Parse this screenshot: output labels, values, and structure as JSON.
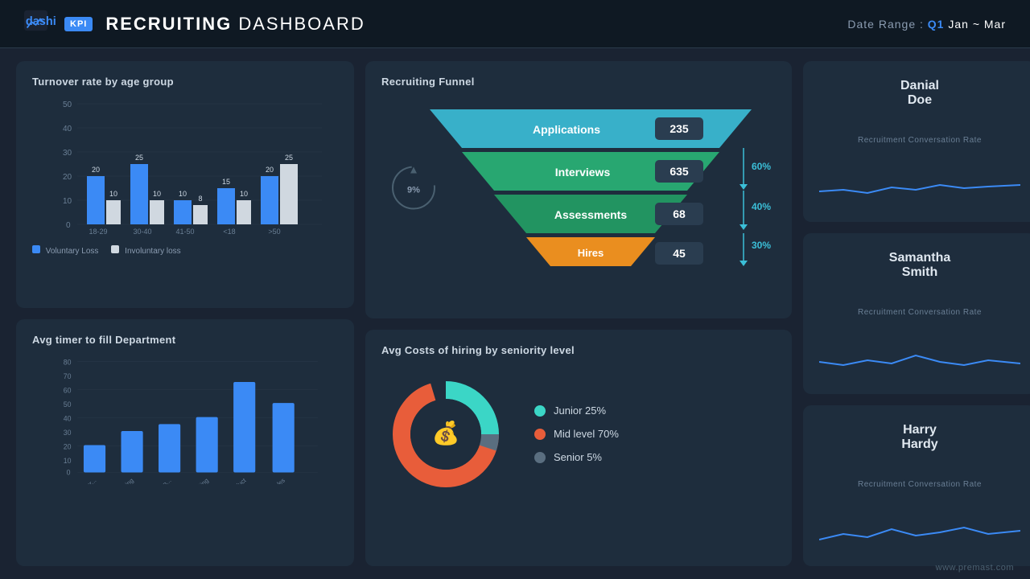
{
  "header": {
    "logo_text": "dashi",
    "kpi_badge": "KPI",
    "title_bold": "RECRUITING",
    "title_thin": "DASHBOARD",
    "date_label": "Date Range :",
    "date_accent": "Q1",
    "date_range": "Jan ~ Mar"
  },
  "turnover": {
    "title": "Turnover rate by age group",
    "y_labels": [
      "50",
      "40",
      "30",
      "20",
      "10",
      "0"
    ],
    "x_labels": [
      "18-29",
      "30-40",
      "41-50",
      "<18",
      ">50"
    ],
    "voluntary_color": "#3b8af5",
    "involuntary_color": "#e0e0e0",
    "legend_voluntary": "Voluntary Loss",
    "legend_involuntary": "Involuntary loss",
    "bars": [
      {
        "voluntary": 20,
        "involuntary": 10
      },
      {
        "voluntary": 25,
        "involuntary": 10
      },
      {
        "voluntary": 10,
        "involuntary": 8
      },
      {
        "voluntary": 15,
        "involuntary": 10
      },
      {
        "voluntary": 20,
        "involuntary": 25
      }
    ]
  },
  "avg_timer": {
    "title": "Avg timer to fill Department",
    "y_labels": [
      "80",
      "70",
      "60",
      "50",
      "40",
      "30",
      "20",
      "10",
      "0"
    ],
    "x_labels": [
      "Customer...",
      "Engineering",
      "human...",
      "marketing",
      "product",
      "sales"
    ],
    "bar_color": "#3b8af5",
    "values": [
      20,
      30,
      35,
      40,
      65,
      50
    ]
  },
  "funnel": {
    "title": "Recruiting Funnel",
    "stages": [
      {
        "label": "Applications",
        "value": 235,
        "color": "#3bc8e0",
        "pct": null
      },
      {
        "label": "Interviews",
        "value": 635,
        "color": "#2db87a",
        "pct": "60%"
      },
      {
        "label": "Assessments",
        "value": 68,
        "color": "#22a86e",
        "pct": "40%"
      },
      {
        "label": "Hires",
        "value": 45,
        "color": "#f59c2a",
        "pct": "30%"
      }
    ],
    "circle_pct": "9%"
  },
  "avg_costs": {
    "title": "Avg Costs of hiring by seniority level",
    "legend": [
      {
        "label": "Junior 25%",
        "color": "#3bd6c6"
      },
      {
        "label": "Mid level 70%",
        "color": "#e85d3a"
      },
      {
        "label": "Senior 5%",
        "color": "#6a7f95"
      }
    ],
    "donut": {
      "junior_pct": 25,
      "mid_pct": 70,
      "senior_pct": 5
    }
  },
  "persons": [
    {
      "name": "Danial\nDoe",
      "subtitle": "Recruitment Conversation Rate"
    },
    {
      "name": "Samantha\nSmith",
      "subtitle": "Recruitment Conversation Rate"
    },
    {
      "name": "Harry\nHardy",
      "subtitle": "Recruitment Conversation Rate"
    }
  ],
  "footer": {
    "link": "www.premast.com"
  }
}
